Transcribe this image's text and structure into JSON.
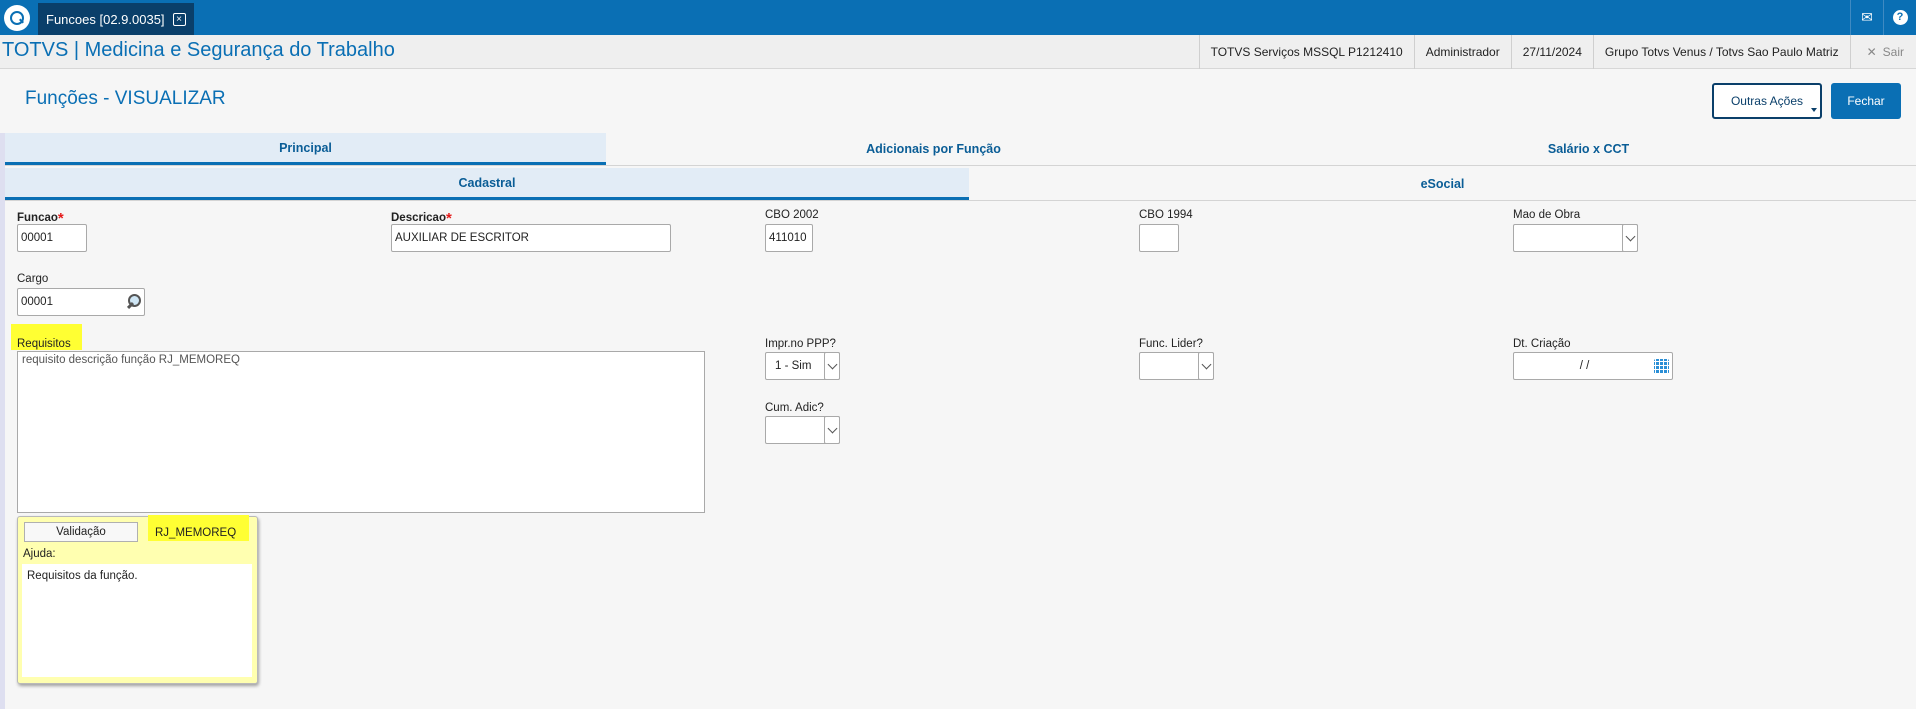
{
  "topbar": {
    "tab_label": "Funcoes [02.9.0035]",
    "tab_close_glyph": "×",
    "mail_glyph": "✉",
    "help_glyph": "?"
  },
  "header": {
    "app_title": "TOTVS | Medicina e Segurança do Trabalho",
    "environment": "TOTVS Serviços MSSQL P1212410",
    "user": "Administrador",
    "date": "27/11/2024",
    "company": "Grupo Totvs Venus / Totvs Sao Paulo Matriz",
    "exit_label": "Sair",
    "exit_glyph": "✕"
  },
  "page": {
    "title": "Funções - VISUALIZAR",
    "other_actions_label": "Outras Ações",
    "close_label": "Fechar"
  },
  "tabs_main": [
    "Principal",
    "Adicionais por Função",
    "Salário x CCT"
  ],
  "tabs_sub": [
    "Cadastral",
    "eSocial"
  ],
  "form": {
    "required_mark": "*",
    "funcao_label": "Funcao",
    "funcao_value": "00001",
    "descricao_label": "Descricao",
    "descricao_value": "AUXILIAR DE ESCRITOR",
    "cbo2002_label": "CBO 2002",
    "cbo2002_value": "411010",
    "cbo1994_label": "CBO 1994",
    "cbo1994_value": "",
    "mao_obra_label": "Mao de Obra",
    "mao_obra_value": "",
    "cargo_label": "Cargo",
    "cargo_value": "00001",
    "requisitos_label": "Requisitos",
    "requisitos_value": "requisito descrição função RJ_MEMOREQ",
    "impr_ppp_label": "Impr.no PPP?",
    "impr_ppp_value": "1 - Sim",
    "func_lider_label": "Func. Lider?",
    "func_lider_value": "",
    "dt_criacao_label": "Dt. Criação",
    "dt_criacao_value": "/ /",
    "cum_adic_label": "Cum. Adic?",
    "cum_adic_value": ""
  },
  "help_panel": {
    "validation_label": "Validação",
    "field_name": "RJ_MEMOREQ",
    "help_label": "Ajuda:",
    "help_text": "Requisitos da função."
  },
  "colors": {
    "primary": "#0a6fb4",
    "dark": "#0a3f6a",
    "required": "#e51b1b",
    "highlight": "#ffff33",
    "help_bg": "#ffffb0"
  }
}
